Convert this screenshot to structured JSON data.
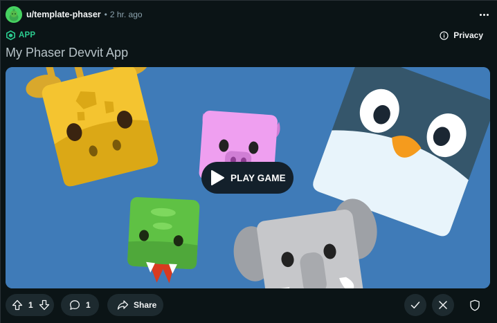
{
  "post": {
    "username": "u/template-phaser",
    "separator": "•",
    "time": "2 hr. ago",
    "app_badge": "APP",
    "privacy_label": "Privacy",
    "title": "My Phaser Devvit App"
  },
  "game": {
    "play_label": "PLAY GAME",
    "background_color": "#3f7bb8"
  },
  "actions": {
    "upvote_count": "1",
    "comment_count": "1",
    "share_label": "Share"
  },
  "icons": {
    "avatar": "snoo-avatar-icon",
    "more": "more-horizontal-icon",
    "app": "app-cube-icon",
    "privacy": "info-circle-icon",
    "play": "play-triangle-icon",
    "upvote": "arrow-up-icon",
    "downvote": "arrow-down-icon",
    "comment": "comment-bubble-icon",
    "share": "share-arrow-icon",
    "approve": "checkmark-icon",
    "remove": "close-icon",
    "mod": "shield-icon"
  },
  "colors": {
    "accent_app": "#2bcb8f",
    "background": "#0b1416",
    "pill": "#1d2a2f"
  }
}
